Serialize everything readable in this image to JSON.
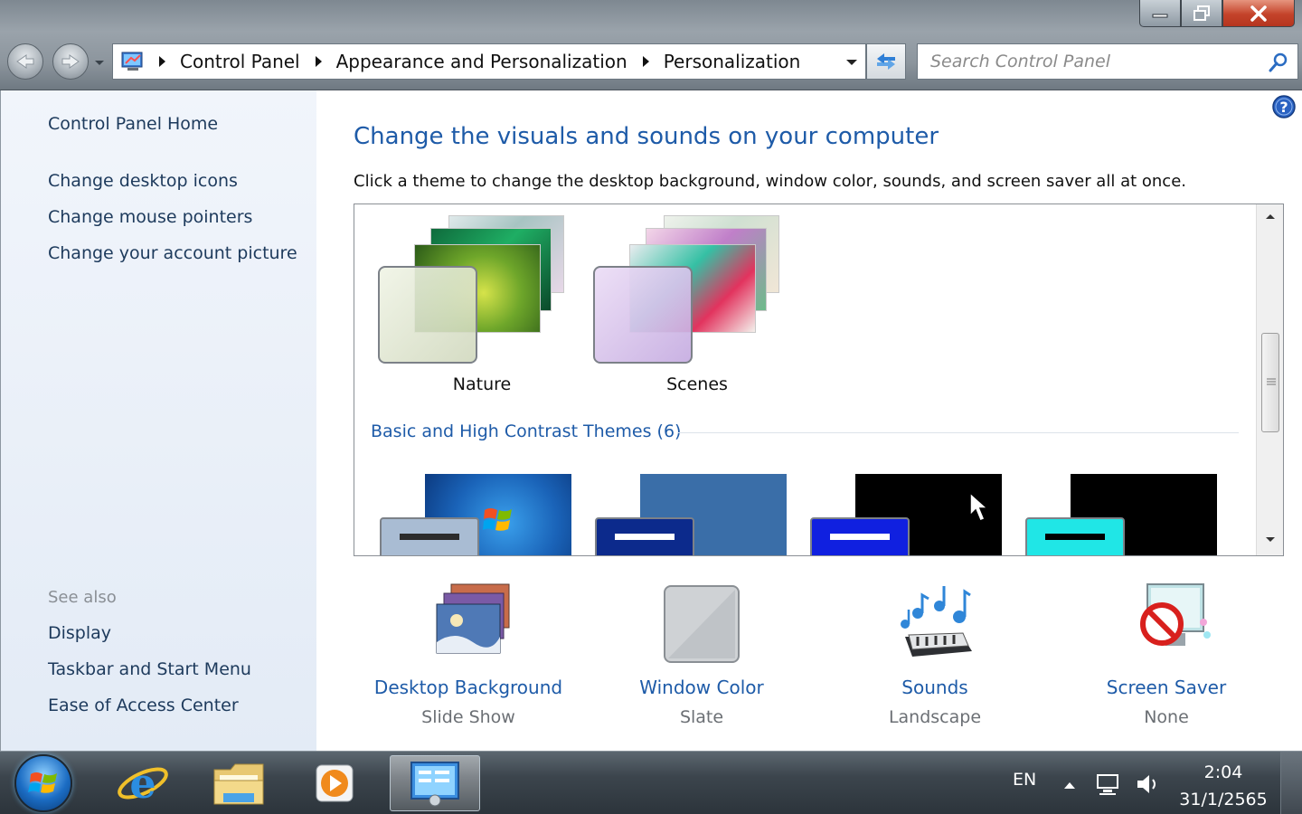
{
  "window": {
    "controls": {
      "minimize": "minimize",
      "restore": "restore",
      "close": "close"
    }
  },
  "address": {
    "crumbs": [
      "Control Panel",
      "Appearance and Personalization",
      "Personalization"
    ]
  },
  "search": {
    "placeholder": "Search Control Panel"
  },
  "sidebar": {
    "home": "Control Panel Home",
    "links": [
      "Change desktop icons",
      "Change mouse pointers",
      "Change your account picture"
    ],
    "see_also_title": "See also",
    "see_also": [
      "Display",
      "Taskbar and Start Menu",
      "Ease of Access Center"
    ]
  },
  "main": {
    "title": "Change the visuals and sounds on your computer",
    "description": "Click a theme to change the desktop background, window color, sounds, and screen saver all at once.",
    "themes": [
      {
        "name": "Nature"
      },
      {
        "name": "Scenes"
      }
    ],
    "basic_section": "Basic and High Contrast Themes (6)",
    "basic_themes": [
      {
        "back_color": "#1a63b8",
        "front_color": "#a9bcd3",
        "bar_color": "#2c2c2c"
      },
      {
        "back_color": "#3a6ea8",
        "front_color": "#0c2a8c",
        "bar_color": "#ffffff"
      },
      {
        "back_color": "#000000",
        "front_color": "#1020e0",
        "bar_color": "#ffffff"
      },
      {
        "back_color": "#000000",
        "front_color": "#20e6e6",
        "bar_color": "#000000"
      }
    ]
  },
  "settings": [
    {
      "label": "Desktop Background",
      "value": "Slide Show",
      "icon": "desktop-background-icon"
    },
    {
      "label": "Window Color",
      "value": "Slate",
      "icon": "window-color-icon"
    },
    {
      "label": "Sounds",
      "value": "Landscape",
      "icon": "sounds-icon"
    },
    {
      "label": "Screen Saver",
      "value": "None",
      "icon": "screen-saver-icon"
    }
  ],
  "taskbar": {
    "language": "EN",
    "time": "2:04",
    "date": "31/1/2565"
  },
  "colors": {
    "link": "#1e5ba8",
    "sidebar_link": "#1d3a5c",
    "muted": "#6b6f74"
  }
}
